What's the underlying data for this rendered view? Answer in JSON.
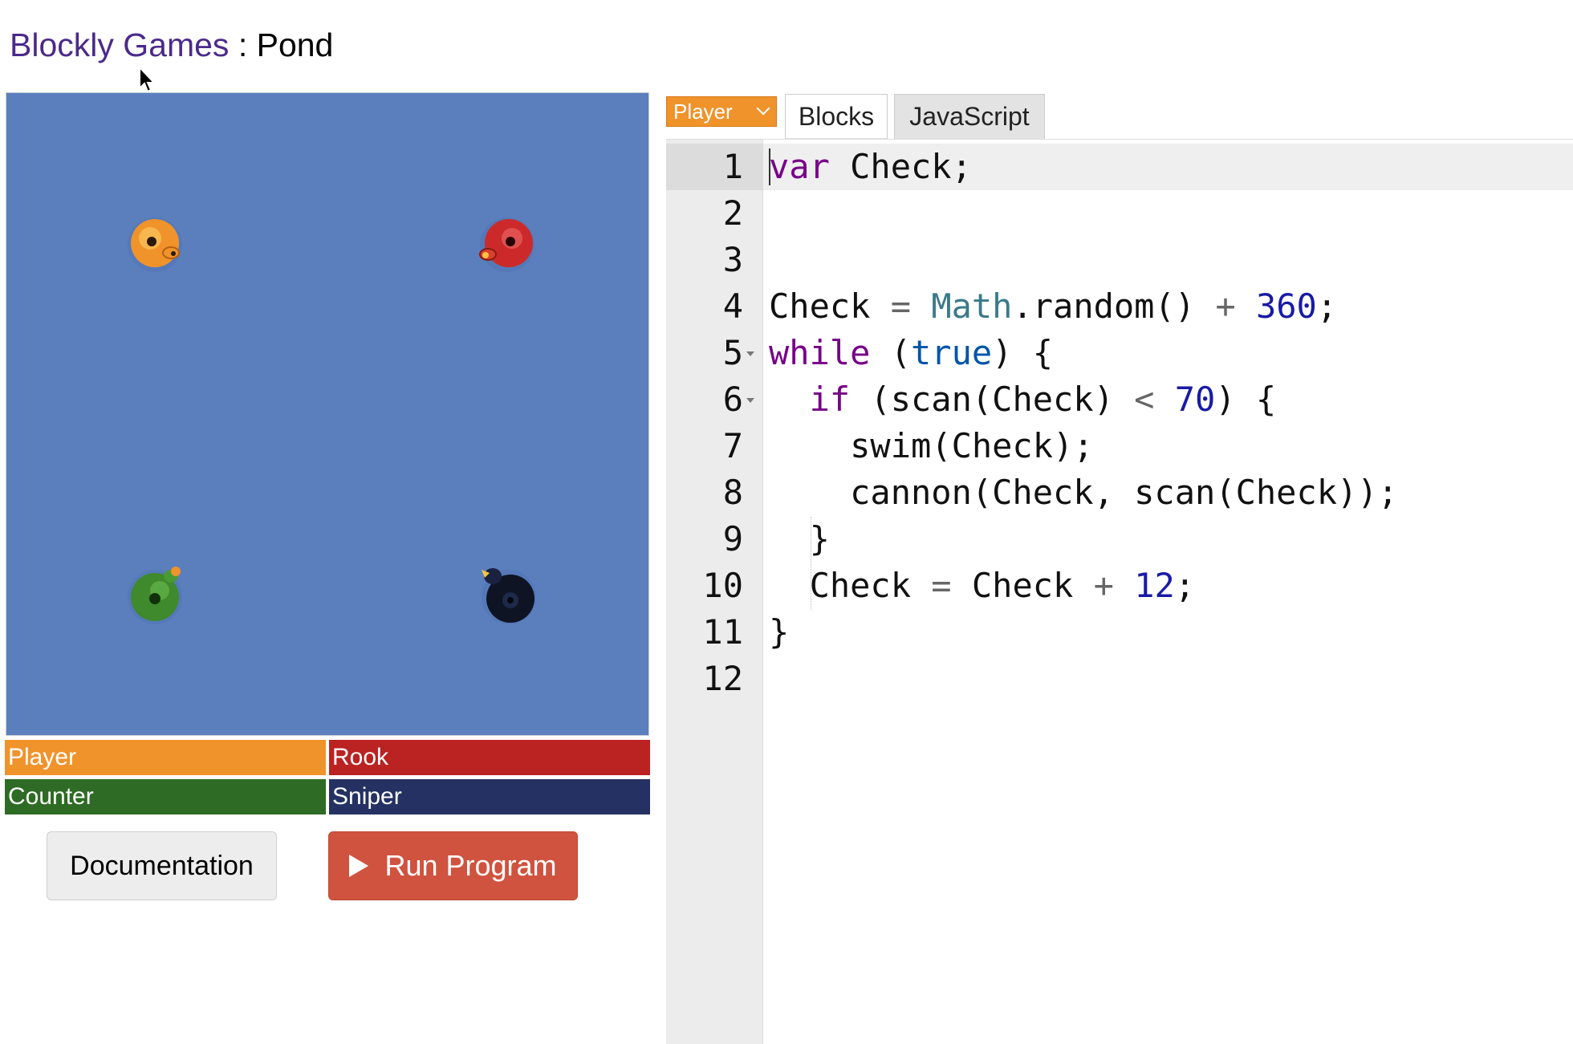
{
  "header": {
    "app_link": "Blockly Games",
    "separator": " : ",
    "page": "Pond"
  },
  "arena": {
    "avatars": [
      {
        "name": "Player",
        "color": "#f0932b"
      },
      {
        "name": "Rook",
        "color": "#c8252a"
      },
      {
        "name": "Counter",
        "color": "#3e8a2c"
      },
      {
        "name": "Sniper",
        "color": "#1c2648"
      }
    ]
  },
  "scoreboard": [
    {
      "label": "Player",
      "color": "#f0932b"
    },
    {
      "label": "Rook",
      "color": "#bb2222"
    },
    {
      "label": "Counter",
      "color": "#2e6b24"
    },
    {
      "label": "Sniper",
      "color": "#243162"
    }
  ],
  "buttons": {
    "documentation": "Documentation",
    "run": "Run Program"
  },
  "editor": {
    "player_select": "Player",
    "tabs": [
      "Blocks",
      "JavaScript"
    ],
    "line_numbers": [
      "1",
      "2",
      "3",
      "4",
      "5",
      "6",
      "7",
      "8",
      "9",
      "10",
      "11",
      "12"
    ],
    "code_lines": [
      "var Check;",
      "",
      "",
      "Check = Math.random() + 360;",
      "while (true) {",
      "  if (scan(Check) < 70) {",
      "    swim(Check);",
      "    cannon(Check, scan(Check));",
      "  }",
      "  Check = Check + 12;",
      "}",
      ""
    ]
  }
}
